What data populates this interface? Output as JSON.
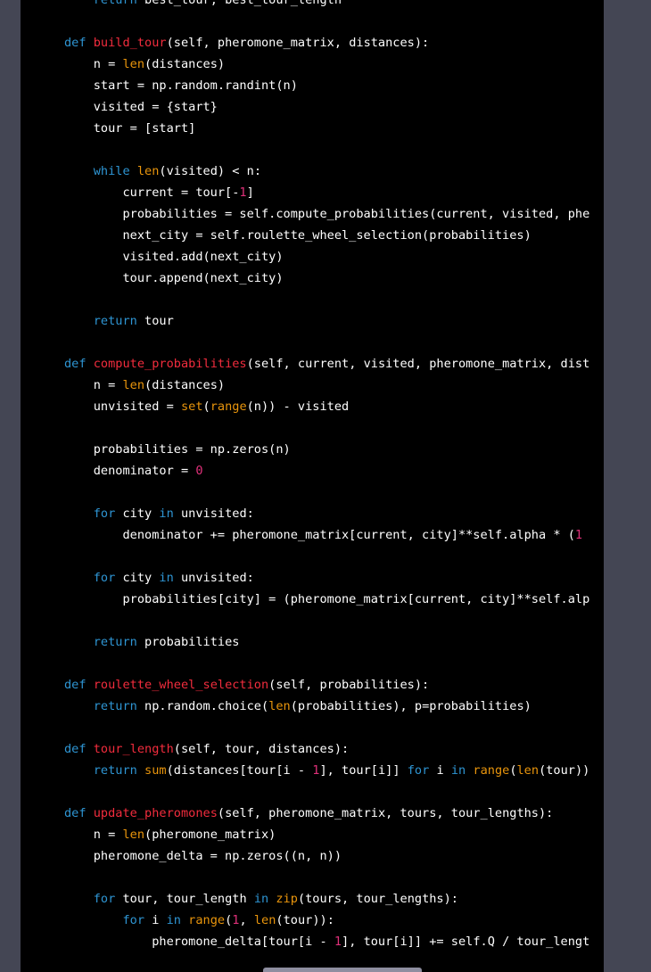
{
  "colors": {
    "background": "#444654",
    "panel": "#000000",
    "text": "#ffffff",
    "keyword": "#2e95d3",
    "function_name": "#f22c3d",
    "builtin": "#e9950c",
    "number": "#df3079"
  },
  "code_lines": [
    [
      {
        "t": "    "
      },
      {
        "t": "return",
        "c": "kw"
      },
      {
        "t": " best_tour, best_tour_length"
      }
    ],
    [],
    [
      {
        "t": "def",
        "c": "kw"
      },
      {
        "t": " "
      },
      {
        "t": "build_tour",
        "c": "fn"
      },
      {
        "t": "(self, pheromone_matrix, distances):"
      }
    ],
    [
      {
        "t": "    n = "
      },
      {
        "t": "len",
        "c": "bi"
      },
      {
        "t": "(distances)"
      }
    ],
    [
      {
        "t": "    start = np.random.randint(n)"
      }
    ],
    [
      {
        "t": "    visited = {start}"
      }
    ],
    [
      {
        "t": "    tour = [start]"
      }
    ],
    [],
    [
      {
        "t": "    "
      },
      {
        "t": "while",
        "c": "kw"
      },
      {
        "t": " "
      },
      {
        "t": "len",
        "c": "bi"
      },
      {
        "t": "(visited) < n:"
      }
    ],
    [
      {
        "t": "        current = tour[-"
      },
      {
        "t": "1",
        "c": "num"
      },
      {
        "t": "]"
      }
    ],
    [
      {
        "t": "        probabilities = self.compute_probabilities(current, visited, phe"
      }
    ],
    [
      {
        "t": "        next_city = self.roulette_wheel_selection(probabilities)"
      }
    ],
    [
      {
        "t": "        visited.add(next_city)"
      }
    ],
    [
      {
        "t": "        tour.append(next_city)"
      }
    ],
    [],
    [
      {
        "t": "    "
      },
      {
        "t": "return",
        "c": "kw"
      },
      {
        "t": " tour"
      }
    ],
    [],
    [
      {
        "t": "def",
        "c": "kw"
      },
      {
        "t": " "
      },
      {
        "t": "compute_probabilities",
        "c": "fn"
      },
      {
        "t": "(self, current, visited, pheromone_matrix, dist"
      }
    ],
    [
      {
        "t": "    n = "
      },
      {
        "t": "len",
        "c": "bi"
      },
      {
        "t": "(distances)"
      }
    ],
    [
      {
        "t": "    unvisited = "
      },
      {
        "t": "set",
        "c": "bi"
      },
      {
        "t": "("
      },
      {
        "t": "range",
        "c": "bi"
      },
      {
        "t": "(n)) - visited"
      }
    ],
    [],
    [
      {
        "t": "    probabilities = np.zeros(n)"
      }
    ],
    [
      {
        "t": "    denominator = "
      },
      {
        "t": "0",
        "c": "num"
      }
    ],
    [],
    [
      {
        "t": "    "
      },
      {
        "t": "for",
        "c": "kw"
      },
      {
        "t": " city "
      },
      {
        "t": "in",
        "c": "kw"
      },
      {
        "t": " unvisited:"
      }
    ],
    [
      {
        "t": "        denominator += pheromone_matrix[current, city]**self.alpha * ("
      },
      {
        "t": "1",
        "c": "num"
      }
    ],
    [],
    [
      {
        "t": "    "
      },
      {
        "t": "for",
        "c": "kw"
      },
      {
        "t": " city "
      },
      {
        "t": "in",
        "c": "kw"
      },
      {
        "t": " unvisited:"
      }
    ],
    [
      {
        "t": "        probabilities[city] = (pheromone_matrix[current, city]**self.alp"
      }
    ],
    [],
    [
      {
        "t": "    "
      },
      {
        "t": "return",
        "c": "kw"
      },
      {
        "t": " probabilities"
      }
    ],
    [],
    [
      {
        "t": "def",
        "c": "kw"
      },
      {
        "t": " "
      },
      {
        "t": "roulette_wheel_selection",
        "c": "fn"
      },
      {
        "t": "(self, probabilities):"
      }
    ],
    [
      {
        "t": "    "
      },
      {
        "t": "return",
        "c": "kw"
      },
      {
        "t": " np.random.choice("
      },
      {
        "t": "len",
        "c": "bi"
      },
      {
        "t": "(probabilities), p=probabilities)"
      }
    ],
    [],
    [
      {
        "t": "def",
        "c": "kw"
      },
      {
        "t": " "
      },
      {
        "t": "tour_length",
        "c": "fn"
      },
      {
        "t": "(self, tour, distances):"
      }
    ],
    [
      {
        "t": "    "
      },
      {
        "t": "return",
        "c": "kw"
      },
      {
        "t": " "
      },
      {
        "t": "sum",
        "c": "bi"
      },
      {
        "t": "(distances[tour[i - "
      },
      {
        "t": "1",
        "c": "num"
      },
      {
        "t": "], tour[i]] "
      },
      {
        "t": "for",
        "c": "kw"
      },
      {
        "t": " i "
      },
      {
        "t": "in",
        "c": "kw"
      },
      {
        "t": " "
      },
      {
        "t": "range",
        "c": "bi"
      },
      {
        "t": "("
      },
      {
        "t": "len",
        "c": "bi"
      },
      {
        "t": "(tour))"
      }
    ],
    [],
    [
      {
        "t": "def",
        "c": "kw"
      },
      {
        "t": " "
      },
      {
        "t": "update_pheromones",
        "c": "fn"
      },
      {
        "t": "(self, pheromone_matrix, tours, tour_lengths):"
      }
    ],
    [
      {
        "t": "    n = "
      },
      {
        "t": "len",
        "c": "bi"
      },
      {
        "t": "(pheromone_matrix)"
      }
    ],
    [
      {
        "t": "    pheromone_delta = np.zeros((n, n))"
      }
    ],
    [],
    [
      {
        "t": "    "
      },
      {
        "t": "for",
        "c": "kw"
      },
      {
        "t": " tour, tour_length "
      },
      {
        "t": "in",
        "c": "kw"
      },
      {
        "t": " "
      },
      {
        "t": "zip",
        "c": "bi"
      },
      {
        "t": "(tours, tour_lengths):"
      }
    ],
    [
      {
        "t": "        "
      },
      {
        "t": "for",
        "c": "kw"
      },
      {
        "t": " i "
      },
      {
        "t": "in",
        "c": "kw"
      },
      {
        "t": " "
      },
      {
        "t": "range",
        "c": "bi"
      },
      {
        "t": "("
      },
      {
        "t": "1",
        "c": "num"
      },
      {
        "t": ", "
      },
      {
        "t": "len",
        "c": "bi"
      },
      {
        "t": "(tour)):"
      }
    ],
    [
      {
        "t": "            pheromone_delta[tour[i - "
      },
      {
        "t": "1",
        "c": "num"
      },
      {
        "t": "], tour[i]] += self.Q / tour_lengt"
      }
    ]
  ]
}
